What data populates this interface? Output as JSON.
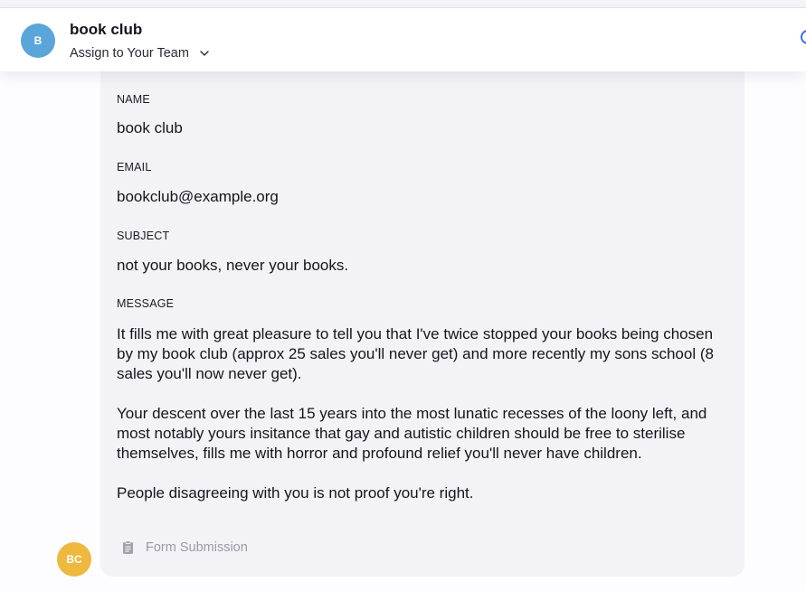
{
  "header": {
    "avatar_initial": "B",
    "contact_name": "book club",
    "assign_label": "Assign to Your Team",
    "assign_icon": "chevron-down-icon"
  },
  "submission": {
    "fields": {
      "name_label": "NAME",
      "name_value": "book club",
      "email_label": "EMAIL",
      "email_value": "bookclub@example.org",
      "subject_label": "SUBJECT",
      "subject_value": "not your books, never your books.",
      "message_label": "MESSAGE",
      "message_paragraphs": [
        "It fills me with great pleasure to tell you that I've twice stopped your books being chosen by my book club (approx 25 sales you'll never get) and more recently my sons school (8 sales you'll now never get).",
        "Your descent over the last 15 years into the most lunatic recesses of the loony left, and most notably yours insitance that gay and autistic children should be free to sterilise themselves, fills me with horror and profound relief you'll never have children.",
        "People disagreeing with you is not proof you're right."
      ]
    },
    "source_icon": "document-icon",
    "source_label": "Form Submission",
    "sender_initials": "BC"
  },
  "colors": {
    "avatar_b": "#5aa6db",
    "avatar_bc": "#efb83f",
    "card_bg": "#f2f2f7",
    "muted_text": "#9b9ba6"
  }
}
